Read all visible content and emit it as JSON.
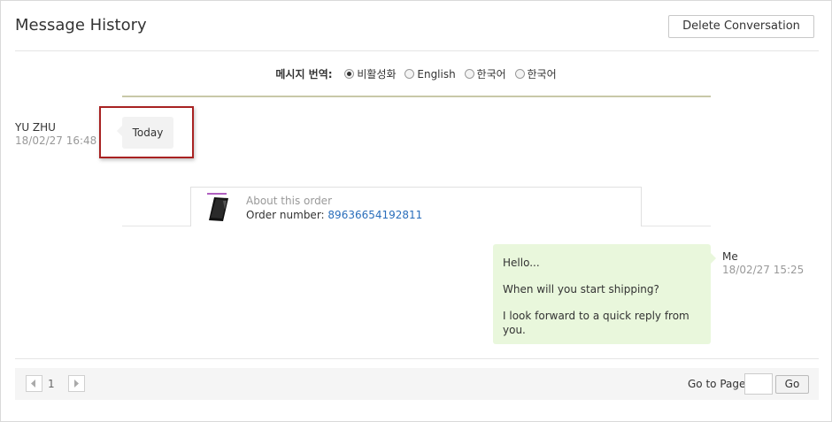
{
  "header": {
    "title": "Message History",
    "delete_label": "Delete Conversation"
  },
  "translate": {
    "label": "메시지 번역:",
    "options": [
      {
        "label": "비활성화",
        "checked": true
      },
      {
        "label": "English",
        "checked": false
      },
      {
        "label": "한국어",
        "checked": false
      },
      {
        "label": "한국어",
        "checked": false
      }
    ]
  },
  "messages": {
    "left": {
      "sender": "YU ZHU",
      "time": "18/02/27 16:48",
      "text": "Today"
    },
    "order": {
      "about": "About this order",
      "number_label": "Order number:",
      "number": "89636654192811"
    },
    "right": {
      "sender": "Me",
      "time": "18/02/27 15:25",
      "lines": [
        "Hello...",
        "When will you start shipping?",
        "I look forward to a quick reply from you."
      ]
    }
  },
  "pager": {
    "current_page": "1",
    "goto_label": "Go to Page",
    "goto_value": "",
    "go_label": "Go"
  },
  "colors": {
    "highlight": "#a82222",
    "right_bubble": "#e9f7dc",
    "link": "#2a6ebb"
  }
}
